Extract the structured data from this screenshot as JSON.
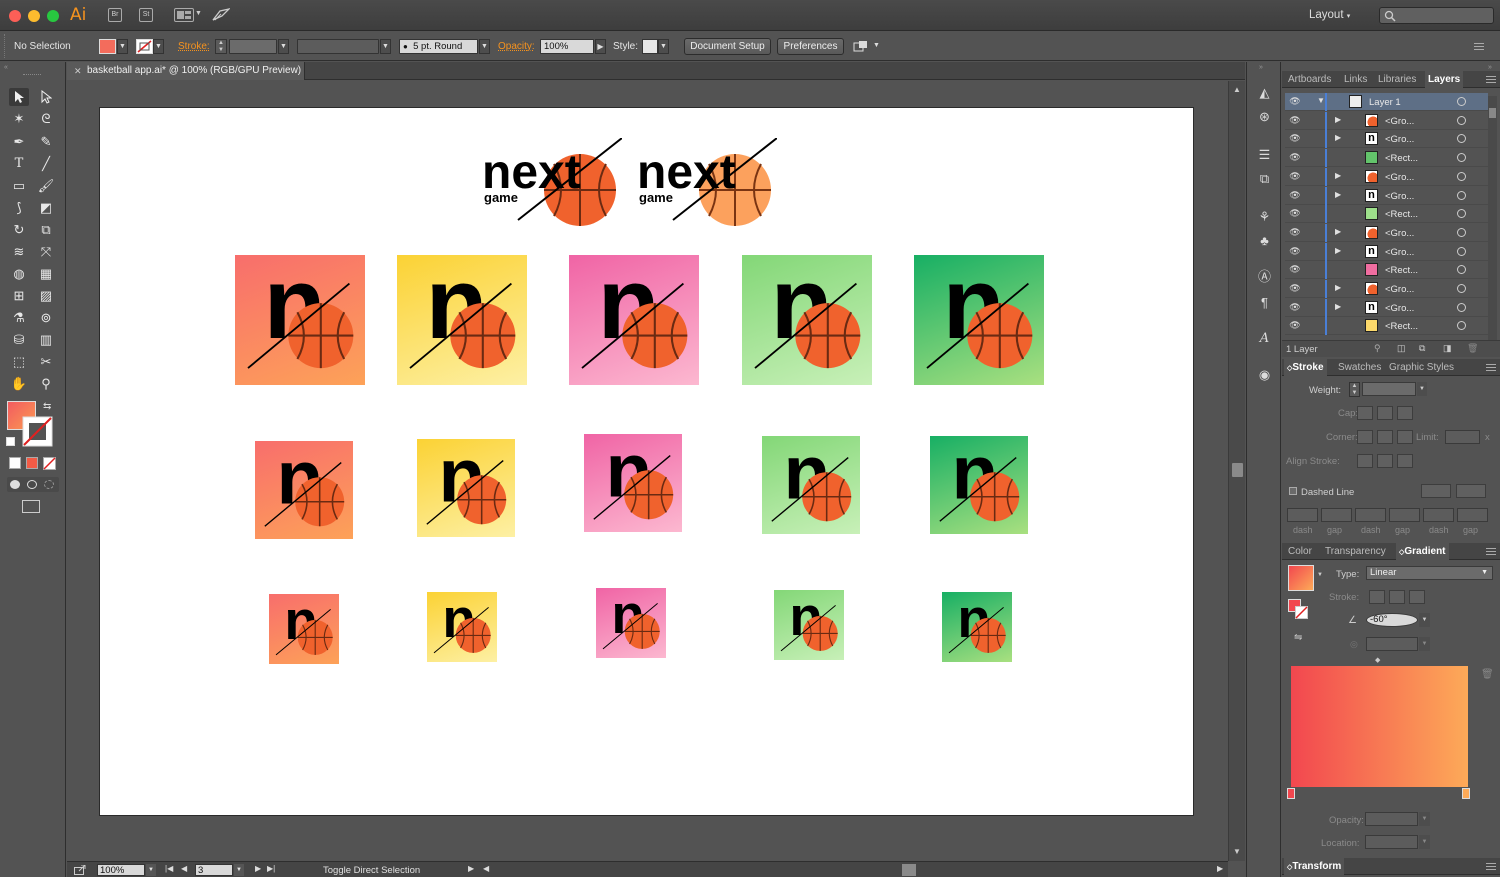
{
  "app": {
    "logo": "Ai",
    "bridge": "Br",
    "stock": "St",
    "workspace": "Layout",
    "search_placeholder": ""
  },
  "control_bar": {
    "selection": "No Selection",
    "stroke_label": "Stroke:",
    "brush": "5 pt. Round",
    "opacity_label": "Opacity:",
    "opacity": "100%",
    "style_label": "Style:",
    "document_setup": "Document Setup",
    "preferences": "Preferences",
    "colors": {
      "fill": "#f36c5c",
      "accent": "#f7931e"
    }
  },
  "document": {
    "tab_title": "basketball app.ai* @ 100% (RGB/GPU Preview)",
    "logo_word": "next",
    "logo_sub": "game",
    "tile_letter": "n"
  },
  "status_bar": {
    "zoom": "100%",
    "artboard": "3",
    "status": "Toggle Direct Selection"
  },
  "layers_panel": {
    "tabs": [
      "Artboards",
      "Links",
      "Libraries",
      "Layers"
    ],
    "active_tab": "Layers",
    "rows": [
      {
        "name": "Layer 1",
        "type": "layer",
        "selected": true
      },
      {
        "name": "<Gro...",
        "type": "group",
        "thumb": "ball"
      },
      {
        "name": "<Gro...",
        "type": "group",
        "thumb": "n"
      },
      {
        "name": "<Rect...",
        "type": "rect",
        "thumb_color": "#63c46b"
      },
      {
        "name": "<Gro...",
        "type": "group",
        "thumb": "ball"
      },
      {
        "name": "<Gro...",
        "type": "group",
        "thumb": "n"
      },
      {
        "name": "<Rect...",
        "type": "rect",
        "thumb_color": "#9ee08b"
      },
      {
        "name": "<Gro...",
        "type": "group",
        "thumb": "ball"
      },
      {
        "name": "<Gro...",
        "type": "group",
        "thumb": "n"
      },
      {
        "name": "<Rect...",
        "type": "rect",
        "thumb_color": "#f06da0"
      },
      {
        "name": "<Gro...",
        "type": "group",
        "thumb": "ball"
      },
      {
        "name": "<Gro...",
        "type": "group",
        "thumb": "n"
      },
      {
        "name": "<Rect...",
        "type": "rect",
        "thumb_color": "#fcd96b"
      }
    ],
    "footer": "1 Layer"
  },
  "stroke_panel": {
    "tabs": [
      "Stroke",
      "Swatches",
      "Graphic Styles"
    ],
    "active_tab": "Stroke",
    "weight_label": "Weight:",
    "cap_label": "Cap:",
    "corner_label": "Corner:",
    "limit_label": "Limit:",
    "limit_suffix": "x",
    "align_label": "Align Stroke:",
    "dashed_line": "Dashed Line",
    "dash_labels": [
      "dash",
      "gap",
      "dash",
      "gap",
      "dash",
      "gap"
    ]
  },
  "gradient_panel": {
    "tabs": [
      "Color",
      "Transparency",
      "Gradient"
    ],
    "active_tab": "Gradient",
    "type_label": "Type:",
    "type_value": "Linear",
    "stroke_label": "Stroke:",
    "angle": "-60°",
    "opacity_label": "Opacity:",
    "location_label": "Location:",
    "start_color": "#f2474f",
    "end_color": "#fdaa58"
  },
  "transform_panel": {
    "title": "Transform"
  }
}
